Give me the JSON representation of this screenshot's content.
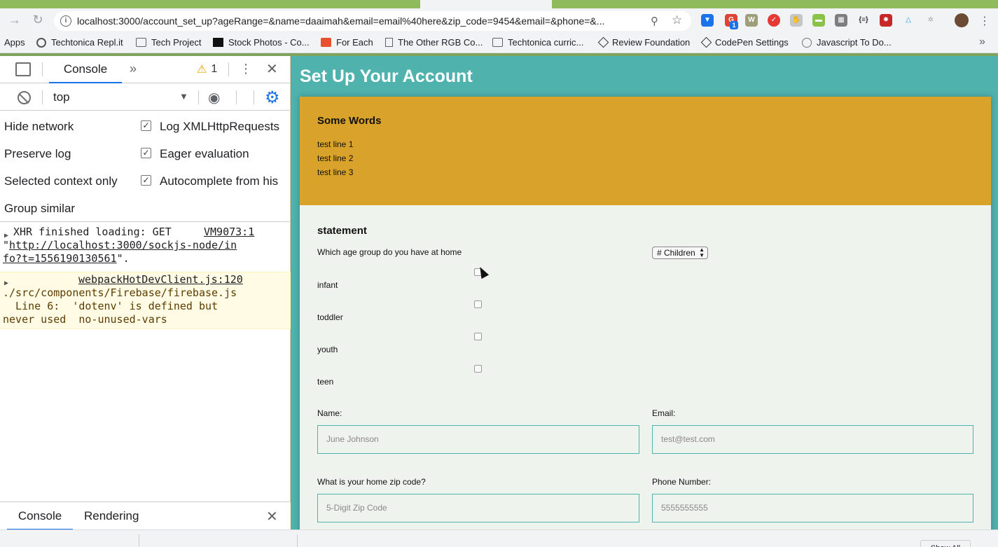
{
  "browser": {
    "url": "localhost:3000/account_set_up?ageRange=&name=daaimah&email=email%40here&zip_code=9454&email=&phone=&...",
    "bookmarks": [
      {
        "label": "Apps",
        "icon": "apps-icon"
      },
      {
        "label": "Techtonica Repl.it",
        "icon": "replit-icon"
      },
      {
        "label": "Tech Project",
        "icon": "folder-icon"
      },
      {
        "label": "Stock Photos - Co...",
        "icon": "unsplash-icon"
      },
      {
        "label": "For Each",
        "icon": "foreach-icon"
      },
      {
        "label": "The Other RGB Co...",
        "icon": "document-icon"
      },
      {
        "label": "Techtonica curric...",
        "icon": "folder-icon"
      },
      {
        "label": "Review Foundation",
        "icon": "codepen-icon"
      },
      {
        "label": "CodePen Settings",
        "icon": "codepen-icon"
      },
      {
        "label": "Javascript To Do...",
        "icon": "smiley-icon"
      }
    ],
    "extension_badge": "1",
    "colors": {
      "chrome_bg": "#f1f3f4",
      "accent": "#1a73e8"
    }
  },
  "devtools": {
    "active_tab": "Console",
    "warning_count": "1",
    "context": "top",
    "settings": {
      "hide_network": "Hide network",
      "preserve_log": "Preserve log",
      "selected_context_only": "Selected context only",
      "group_similar": "Group similar",
      "log_xhr": "Log XMLHttpRequests",
      "eager_eval": "Eager evaluation",
      "autocomplete": "Autocomplete from his"
    },
    "messages": {
      "xhr_text": "XHR finished loading: GET",
      "xhr_source": "VM9073:1",
      "xhr_quote_open": "\"",
      "xhr_url_1": "http://localhost:3000/sockjs-node/in",
      "xhr_url_2": "fo?t=1556190130561",
      "xhr_quote_close": "\".",
      "warn_source": "webpackHotDevClient.js:120",
      "warn_line1": "./src/components/Firebase/firebase.js",
      "warn_line2": "  Line 6:  'dotenv' is defined but",
      "warn_line3": "never used  no-unused-vars"
    },
    "drawer_tabs": [
      "Console",
      "Rendering"
    ]
  },
  "page": {
    "title": "Set Up Your Account",
    "header_card": {
      "heading": "Some Words",
      "lines": [
        "test line 1",
        "test line 2",
        "test line 3"
      ]
    },
    "statement_heading": "statement",
    "age_question": "Which age group do you have at home",
    "children_select": "# Children",
    "age_groups": [
      "infant",
      "toddler",
      "youth",
      "teen"
    ],
    "fields": {
      "name_label": "Name:",
      "name_placeholder": "June Johnson",
      "email_label": "Email:",
      "email_placeholder": "test@test.com",
      "zip_label": "What is your home zip code?",
      "zip_placeholder": "5-Digit Zip Code",
      "phone_label": "Phone Number:",
      "phone_placeholder": "5555555555"
    },
    "colors": {
      "page_bg": "#4fb2ad",
      "header_card": "#d9a22a",
      "card_bg": "#eef3ed"
    }
  },
  "downloads": {
    "show_all": "Show All"
  }
}
